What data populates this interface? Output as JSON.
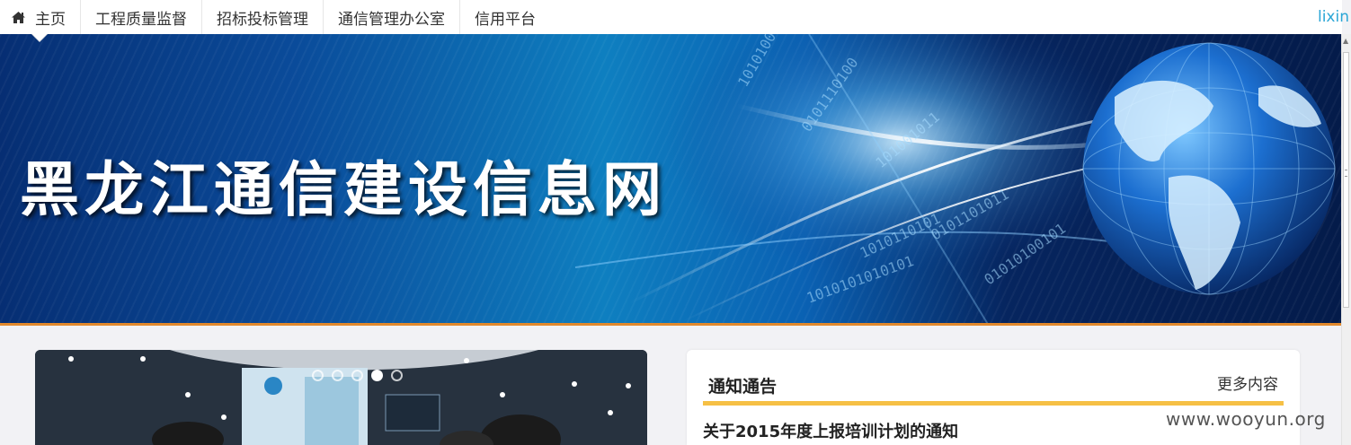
{
  "nav": {
    "items": [
      {
        "label": "主页",
        "active": true
      },
      {
        "label": "工程质量监督"
      },
      {
        "label": "招标投标管理"
      },
      {
        "label": "通信管理办公室"
      },
      {
        "label": "信用平台"
      }
    ],
    "user": "lixin"
  },
  "banner": {
    "title": "黑龙江通信建设信息网",
    "accent_color": "#e2892c"
  },
  "slider": {
    "dots": 5,
    "active_index": 3
  },
  "notice": {
    "title": "通知通告",
    "more": "更多内容",
    "rule_color": "#f6c045",
    "items": [
      "关于2015年度上报培训计划的通知"
    ]
  },
  "watermark": "www.wooyun.org"
}
